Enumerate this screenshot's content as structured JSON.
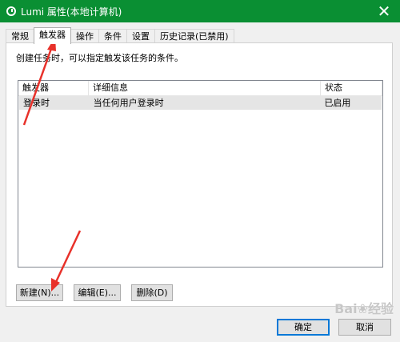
{
  "window": {
    "title": "Lumi 属性(本地计算机)",
    "close_glyph": "✕",
    "titlebar_color": "#0a8f33"
  },
  "tabs": [
    {
      "label": "常规"
    },
    {
      "label": "触发器"
    },
    {
      "label": "操作"
    },
    {
      "label": "条件"
    },
    {
      "label": "设置"
    },
    {
      "label": "历史记录(已禁用)"
    }
  ],
  "active_tab": "触发器",
  "panel": {
    "description": "创建任务时，可以指定触发该任务的条件。",
    "list": {
      "columns": [
        "触发器",
        "详细信息",
        "状态"
      ],
      "rows": [
        {
          "trigger": "登录时",
          "details": "当任何用户登录时",
          "status": "已启用"
        }
      ]
    },
    "buttons": {
      "new": "新建(N)...",
      "edit": "编辑(E)...",
      "delete": "删除(D)"
    }
  },
  "dialog_buttons": {
    "ok": "确定",
    "cancel": "取消"
  },
  "annotation_color": "#e8312a",
  "watermark": "Baidu 经验"
}
